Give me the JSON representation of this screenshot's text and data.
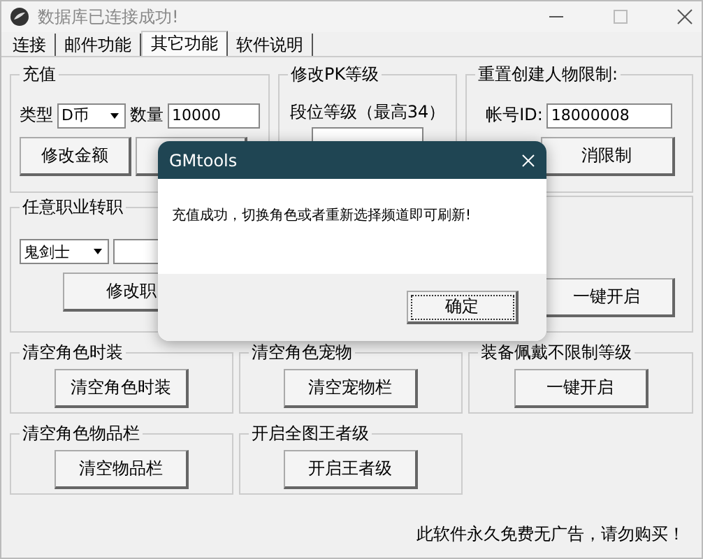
{
  "window": {
    "title": "数据库已连接成功!"
  },
  "tabs": [
    {
      "label": "连接",
      "selected": false
    },
    {
      "label": "邮件功能",
      "selected": false
    },
    {
      "label": "其它功能",
      "selected": true
    },
    {
      "label": "软件说明",
      "selected": false
    }
  ],
  "top_groups": [
    {
      "kind": "recharge",
      "title": "充值",
      "type_label": "类型",
      "type_value": "D币",
      "amount_label": "数量",
      "amount_value": "10000",
      "button": "修改金额"
    },
    {
      "kind": "pk",
      "title": "修改PK等级",
      "label": "段位等级（最高34）"
    },
    {
      "kind": "account",
      "title": "重置创建人物限制:",
      "label": "帐号ID:",
      "value": "18000008",
      "button": "消限制"
    },
    {
      "kind": "job",
      "title": "任意职业转职",
      "select": "鬼剑士",
      "button": "修改职"
    },
    {
      "kind": "hidden"
    },
    {
      "kind": "button",
      "button": "一键开启"
    }
  ],
  "bottom_groups": [
    {
      "title": "清空角色时装",
      "button": "清空角色时装"
    },
    {
      "title": "清空角色宠物",
      "button": "清空宠物栏"
    },
    {
      "title": "装备佩戴不限制等级",
      "button": "一键开启"
    },
    {
      "title": "清空角色物品栏",
      "button": "清空物品栏"
    },
    {
      "title": "开启全图王者级",
      "button": "开启王者级"
    }
  ],
  "footer": "此软件永久免费无广告，请勿购买！",
  "dialog": {
    "title": "GMtools",
    "message": "充值成功，切换角色或者重新选择频道即可刷新!",
    "button": "确定"
  }
}
